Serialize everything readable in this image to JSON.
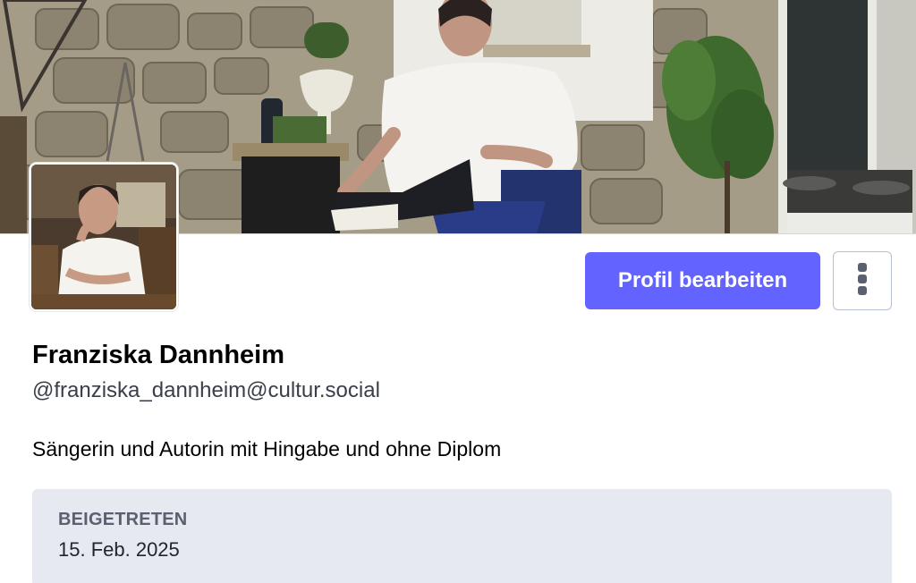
{
  "profile": {
    "display_name": "Franziska Dannheim",
    "handle": "@franziska_dannheim@cultur.social",
    "bio": "Sängerin und Autorin mit Hingabe und ohne Diplom"
  },
  "actions": {
    "edit_profile_label": "Profil bearbeiten",
    "more_icon": "kebab-vertical-icon"
  },
  "fields": [
    {
      "label": "BEIGETRETEN",
      "value": "15. Feb. 2025"
    }
  ],
  "colors": {
    "accent": "#6364ff",
    "field_background": "#e6e9ef",
    "border": "#b7c0d1"
  }
}
